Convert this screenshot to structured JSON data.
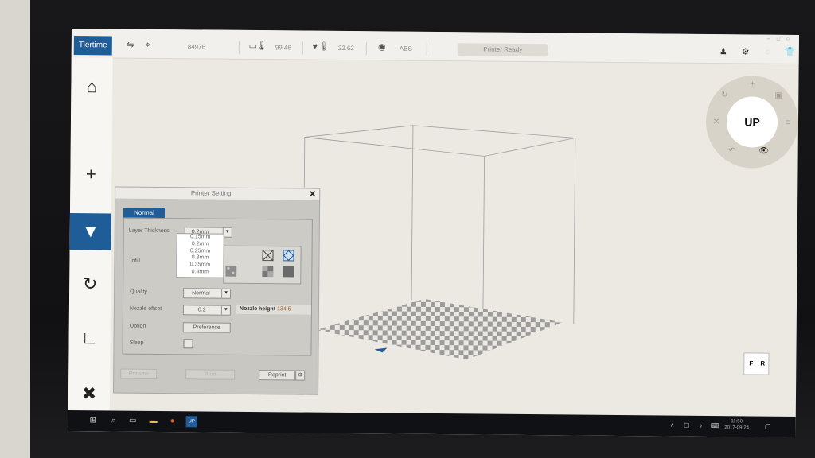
{
  "app": {
    "logo_text": "Tiertime"
  },
  "topbar": {
    "serial": "84976",
    "bed_temp": "99.46",
    "nozzle_temp": "22.62",
    "material": "ABS",
    "status": "Printer Ready"
  },
  "sidebar": {
    "items": [
      {
        "icon": "home-icon",
        "glyph": "⌂"
      },
      {
        "icon": "add-icon",
        "glyph": "+"
      },
      {
        "icon": "printer-icon",
        "glyph": "▼"
      },
      {
        "icon": "rotate-icon",
        "glyph": "↻"
      },
      {
        "icon": "scale-icon",
        "glyph": "∟"
      },
      {
        "icon": "tools-icon",
        "glyph": "✖"
      }
    ]
  },
  "control_wheel": {
    "center_label": "UP"
  },
  "viewcube": {
    "front": "F",
    "right": "R"
  },
  "dialog": {
    "title": "Printer Setting",
    "close": "✕",
    "tab": "Normal",
    "labels": {
      "layer_thickness": "Layer Thickness",
      "infill": "Infill",
      "quality": "Quality",
      "nozzle_offset": "Nozzle offset",
      "option": "Option",
      "sleep": "Sleep"
    },
    "layer_thickness_value": "0.2mm",
    "layer_options": [
      "0.15mm",
      "0.2mm",
      "0.25mm",
      "0.3mm",
      "0.35mm",
      "0.4mm"
    ],
    "quality_value": "Normal",
    "nozzle_offset_value": "0.2",
    "nozzle_height_label": "Nozzle height",
    "nozzle_height_value": "134.5",
    "preference_button": "Preference",
    "footer": {
      "left_button": "Preview",
      "middle_button": "Print",
      "reprint_button": "Reprint"
    }
  },
  "taskbar": {
    "time": "11:50",
    "date": "2017-09-24"
  },
  "colors": {
    "accent": "#1f5d99",
    "background": "#ece9e2",
    "taskbar": "#0f1115"
  }
}
